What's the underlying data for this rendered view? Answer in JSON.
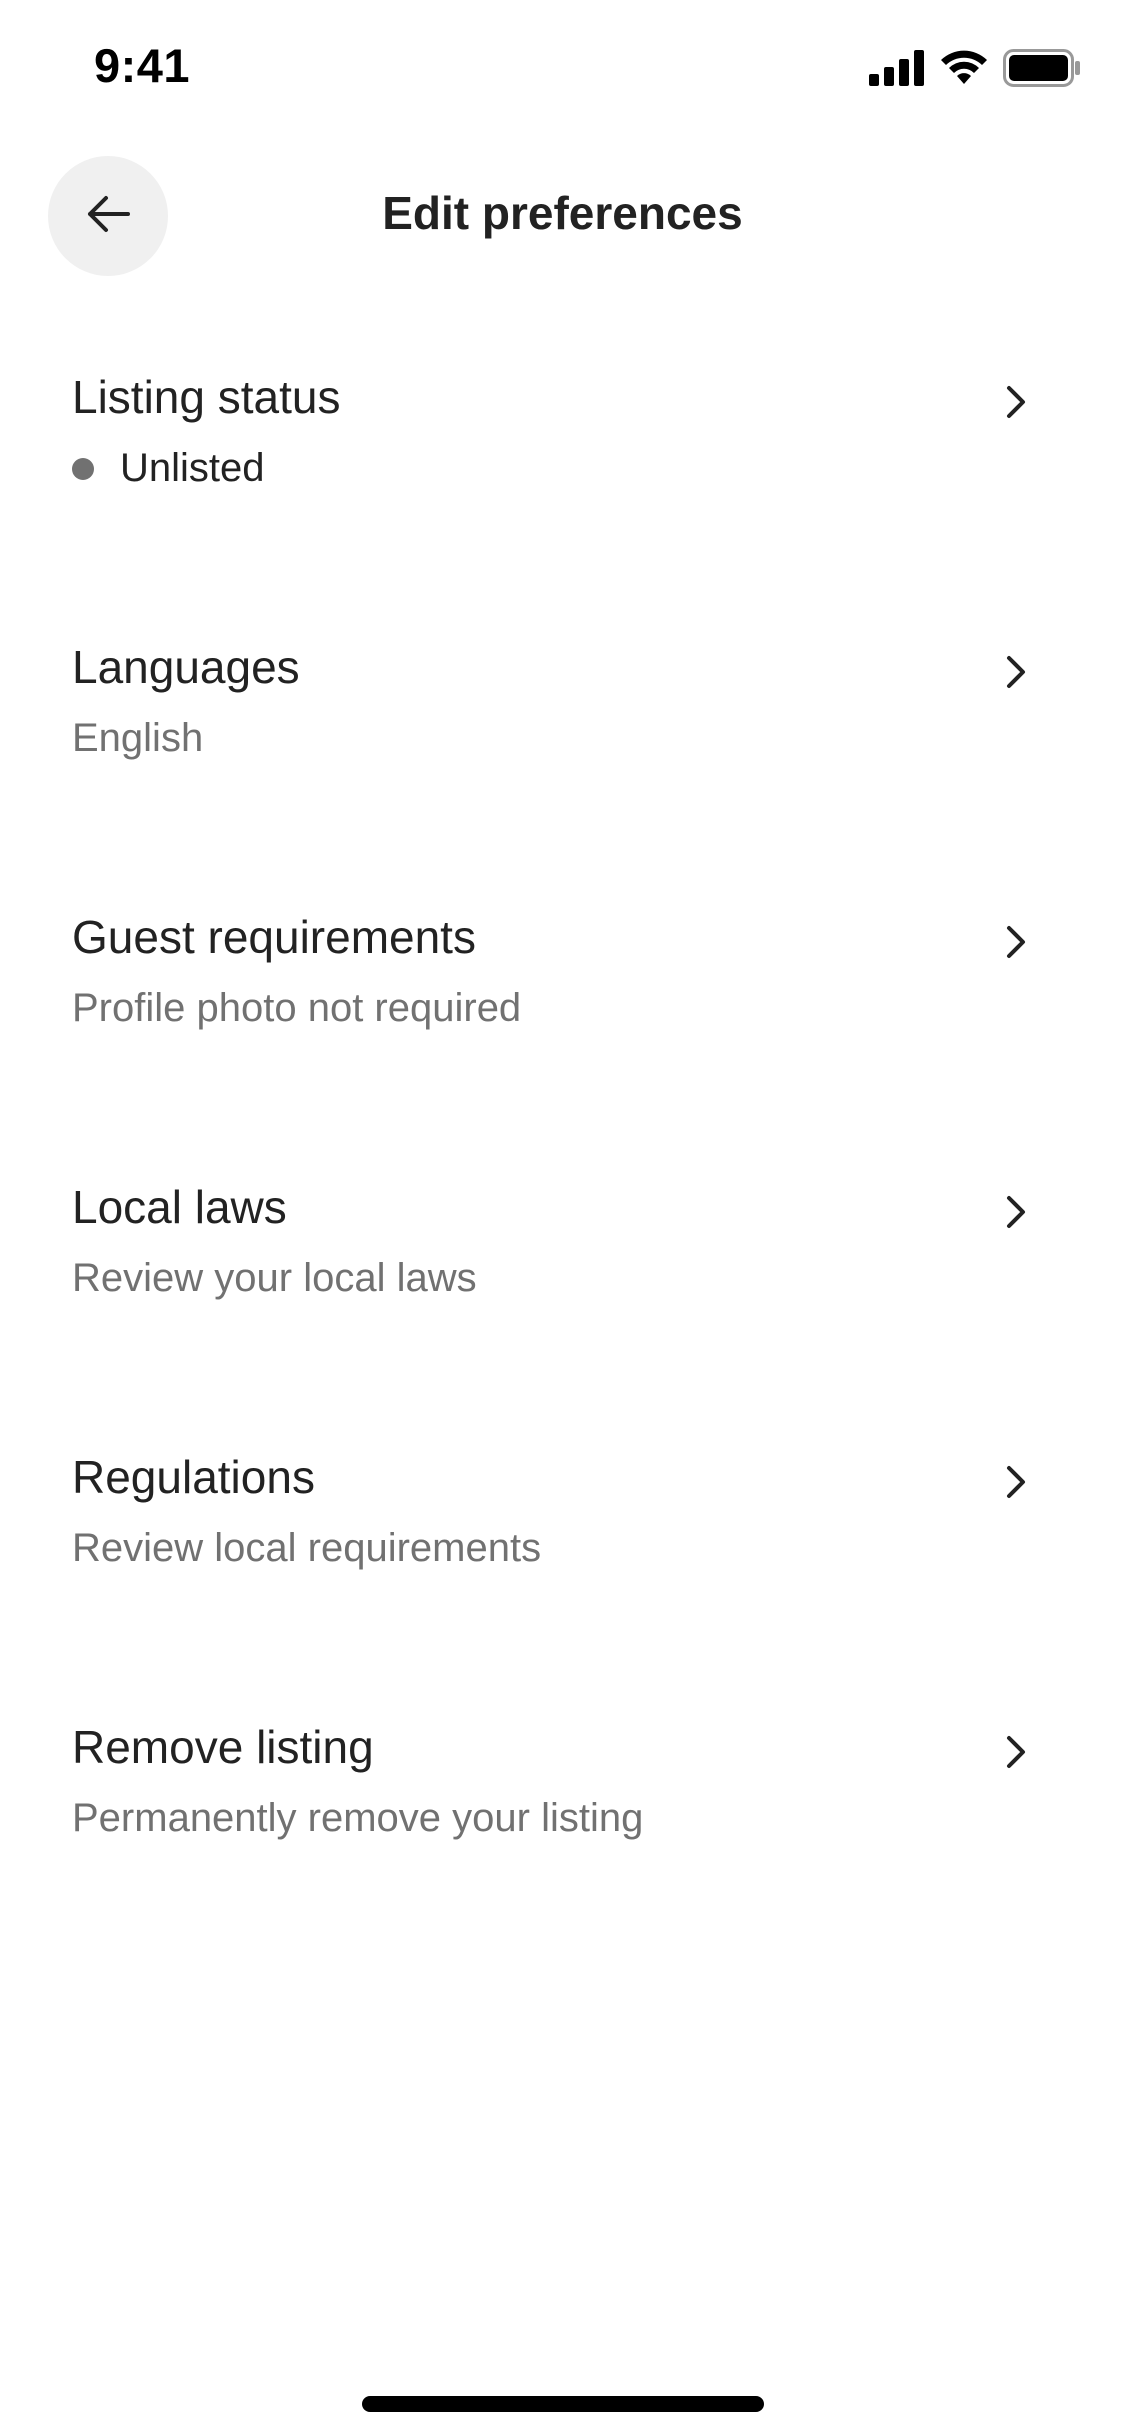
{
  "status_bar": {
    "time": "9:41",
    "icons": [
      "cellular-signal-icon",
      "wifi-icon",
      "battery-icon"
    ]
  },
  "header": {
    "back_icon": "arrow-left-icon",
    "title": "Edit preferences"
  },
  "preferences": [
    {
      "title": "Listing status",
      "subtitle": "Unlisted",
      "status_dot_color": "#717171"
    },
    {
      "title": "Languages",
      "subtitle": "English"
    },
    {
      "title": "Guest requirements",
      "subtitle": "Profile photo not required"
    },
    {
      "title": "Local laws",
      "subtitle": "Review your local laws"
    },
    {
      "title": "Regulations",
      "subtitle": "Review local requirements"
    },
    {
      "title": "Remove listing",
      "subtitle": "Permanently remove your listing"
    }
  ],
  "colors": {
    "text_primary": "#222222",
    "text_secondary": "#717171",
    "back_button_bg": "#f0f0f0"
  }
}
